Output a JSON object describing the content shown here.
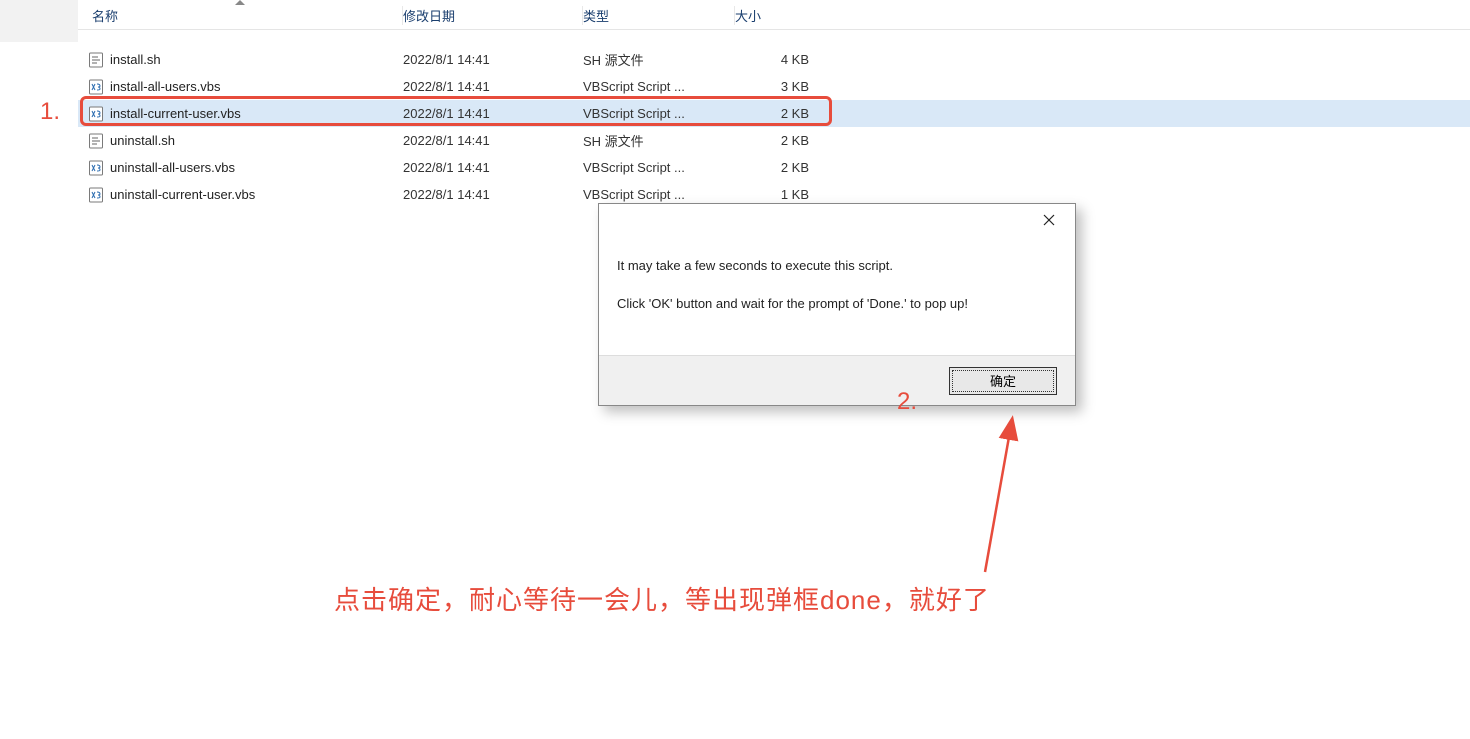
{
  "columns": {
    "name": "名称",
    "date": "修改日期",
    "type": "类型",
    "size": "大小"
  },
  "files": [
    {
      "name": "install.sh",
      "date": "2022/8/1 14:41",
      "type": "SH 源文件",
      "size": "4 KB",
      "icon": "sh"
    },
    {
      "name": "install-all-users.vbs",
      "date": "2022/8/1 14:41",
      "type": "VBScript Script ...",
      "size": "3 KB",
      "icon": "vbs"
    },
    {
      "name": "install-current-user.vbs",
      "date": "2022/8/1 14:41",
      "type": "VBScript Script ...",
      "size": "2 KB",
      "icon": "vbs",
      "selected": true
    },
    {
      "name": "uninstall.sh",
      "date": "2022/8/1 14:41",
      "type": "SH 源文件",
      "size": "2 KB",
      "icon": "sh"
    },
    {
      "name": "uninstall-all-users.vbs",
      "date": "2022/8/1 14:41",
      "type": "VBScript Script ...",
      "size": "2 KB",
      "icon": "vbs"
    },
    {
      "name": "uninstall-current-user.vbs",
      "date": "2022/8/1 14:41",
      "type": "VBScript Script ...",
      "size": "1 KB",
      "icon": "vbs"
    }
  ],
  "dialog": {
    "line1": "It may take a few seconds to execute this script.",
    "line2": "Click 'OK' button and wait for the prompt of 'Done.' to pop up!",
    "ok": "确定"
  },
  "annotations": {
    "step1": "1.",
    "step2": "2.",
    "caption": "点击确定，耐心等待一会儿，等出现弹框done，就好了"
  }
}
